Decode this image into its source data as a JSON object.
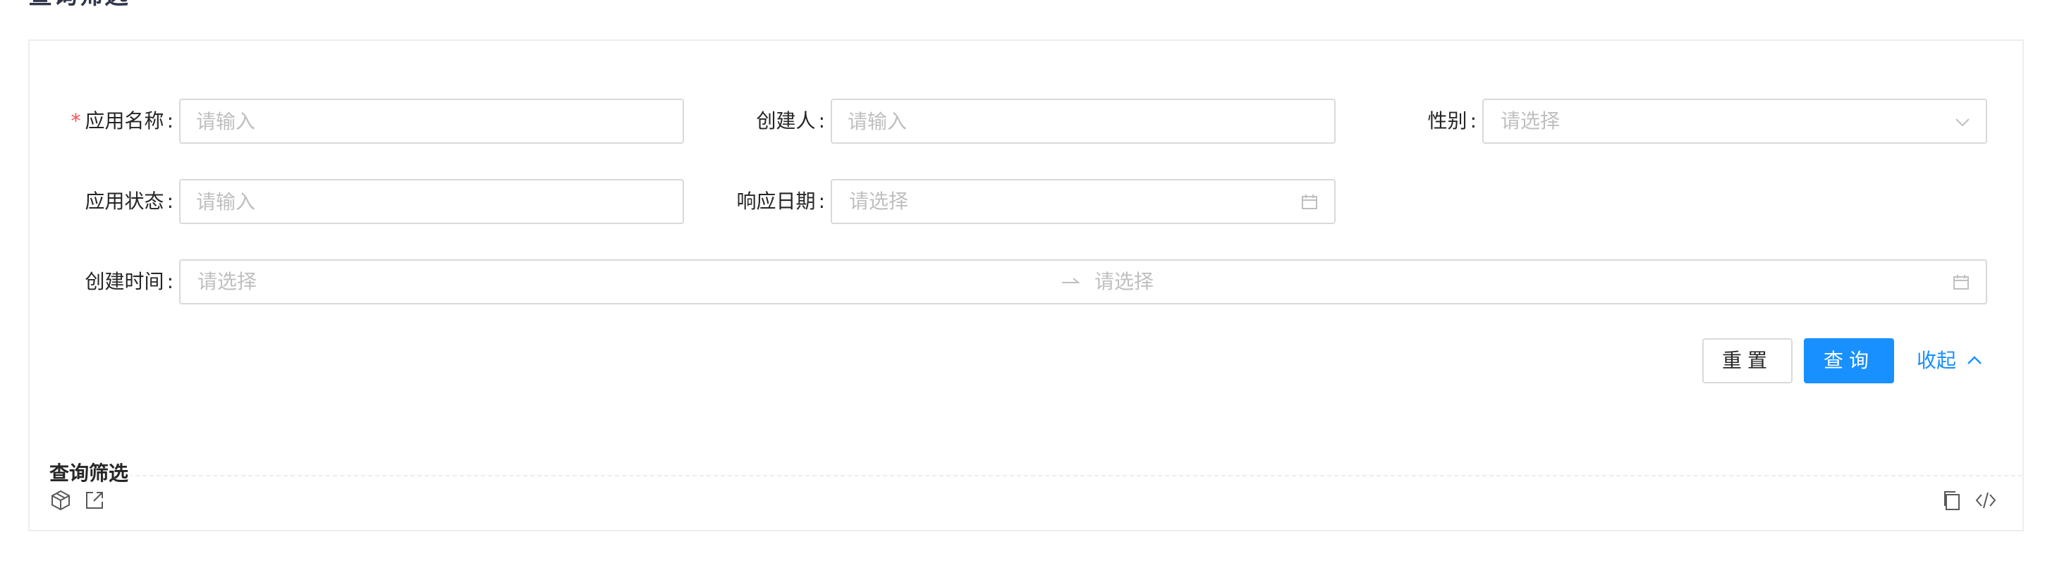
{
  "page": {
    "heading": "查询筛选"
  },
  "form": {
    "app_name": {
      "label": "应用名称",
      "required_mark": "*",
      "colon": ":",
      "placeholder": "请输入"
    },
    "creator": {
      "label": "创建人",
      "colon": ":",
      "placeholder": "请输入"
    },
    "gender": {
      "label": "性别",
      "colon": ":",
      "placeholder": "请选择"
    },
    "app_status": {
      "label": "应用状态",
      "colon": ":",
      "placeholder": "请输入"
    },
    "response_date": {
      "label": "响应日期",
      "colon": ":",
      "placeholder": "请选择"
    },
    "create_time": {
      "label": "创建时间",
      "colon": ":",
      "start_placeholder": "请选择",
      "end_placeholder": "请选择"
    }
  },
  "actions": {
    "reset_label": "重置",
    "query_label": "查询",
    "collapse_label": "收起"
  },
  "demo": {
    "title": "查询筛选"
  },
  "icons": {
    "gender_suffix": "chevron-down-icon",
    "date_suffix": "calendar-icon",
    "range_separator": "arrow-right-icon",
    "collapse": "chevron-up-icon",
    "codesandbox": "codesandbox-icon",
    "open_new": "external-link-icon",
    "copy": "copy-icon",
    "code": "code-icon"
  },
  "colors": {
    "primary": "#1890ff",
    "required": "#ff4d4f",
    "border": "#d9d9d9",
    "placeholder": "#bfbfbf"
  }
}
